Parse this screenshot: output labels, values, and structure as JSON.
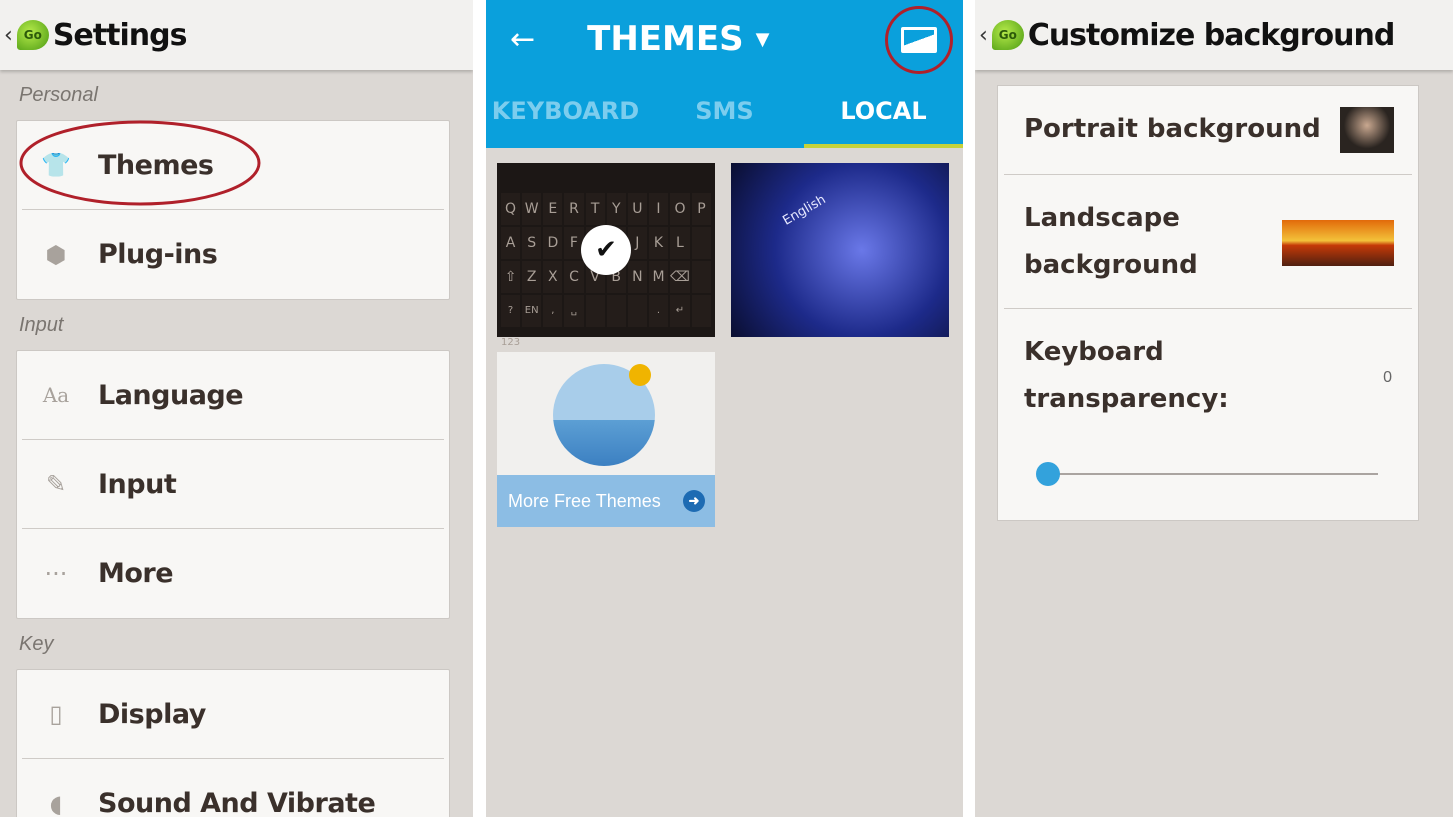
{
  "settings": {
    "title": "Settings",
    "sections": [
      {
        "label": "Personal",
        "items": [
          {
            "label": "Themes",
            "icon": "tshirt-icon"
          },
          {
            "label": "Plug-ins",
            "icon": "cube-icon"
          }
        ]
      },
      {
        "label": "Input",
        "items": [
          {
            "label": "Language",
            "icon": "aa-icon"
          },
          {
            "label": "Input",
            "icon": "pencil-icon"
          },
          {
            "label": "More",
            "icon": "dots-icon"
          }
        ]
      },
      {
        "label": "Key",
        "items": [
          {
            "label": "Display",
            "icon": "phone-icon"
          },
          {
            "label": "Sound And Vibrate",
            "icon": "speaker-icon"
          }
        ]
      }
    ]
  },
  "themes": {
    "title": "THEMES",
    "tabs": [
      {
        "label": "KEYBOARD"
      },
      {
        "label": "SMS"
      },
      {
        "label": "LOCAL",
        "active": true
      }
    ],
    "keyboard_keys": [
      "Q",
      "W",
      "E",
      "R",
      "T",
      "Y",
      "U",
      "I",
      "O",
      "P",
      "A",
      "S",
      "D",
      "F",
      "G",
      "H",
      "J",
      "K",
      "L",
      "",
      "⇧",
      "Z",
      "X",
      "C",
      "V",
      "B",
      "N",
      "M",
      "⌫",
      "",
      "?123",
      "EN",
      ",",
      "␣",
      "",
      "",
      "",
      ".",
      "↵",
      ""
    ],
    "theme2_text": "English",
    "more_label": "More Free Themes",
    "accent": "#0aa0dc",
    "tab_indicator": "#c6d23a"
  },
  "customize": {
    "title": "Customize background",
    "portrait": "Portrait background",
    "landscape": "Landscape background",
    "transparency_label": "Keyboard transparency:",
    "transparency_value": "0",
    "transparency_percent": 0,
    "slider_color": "#33a2dc"
  },
  "annotation_color": "#b0202a"
}
